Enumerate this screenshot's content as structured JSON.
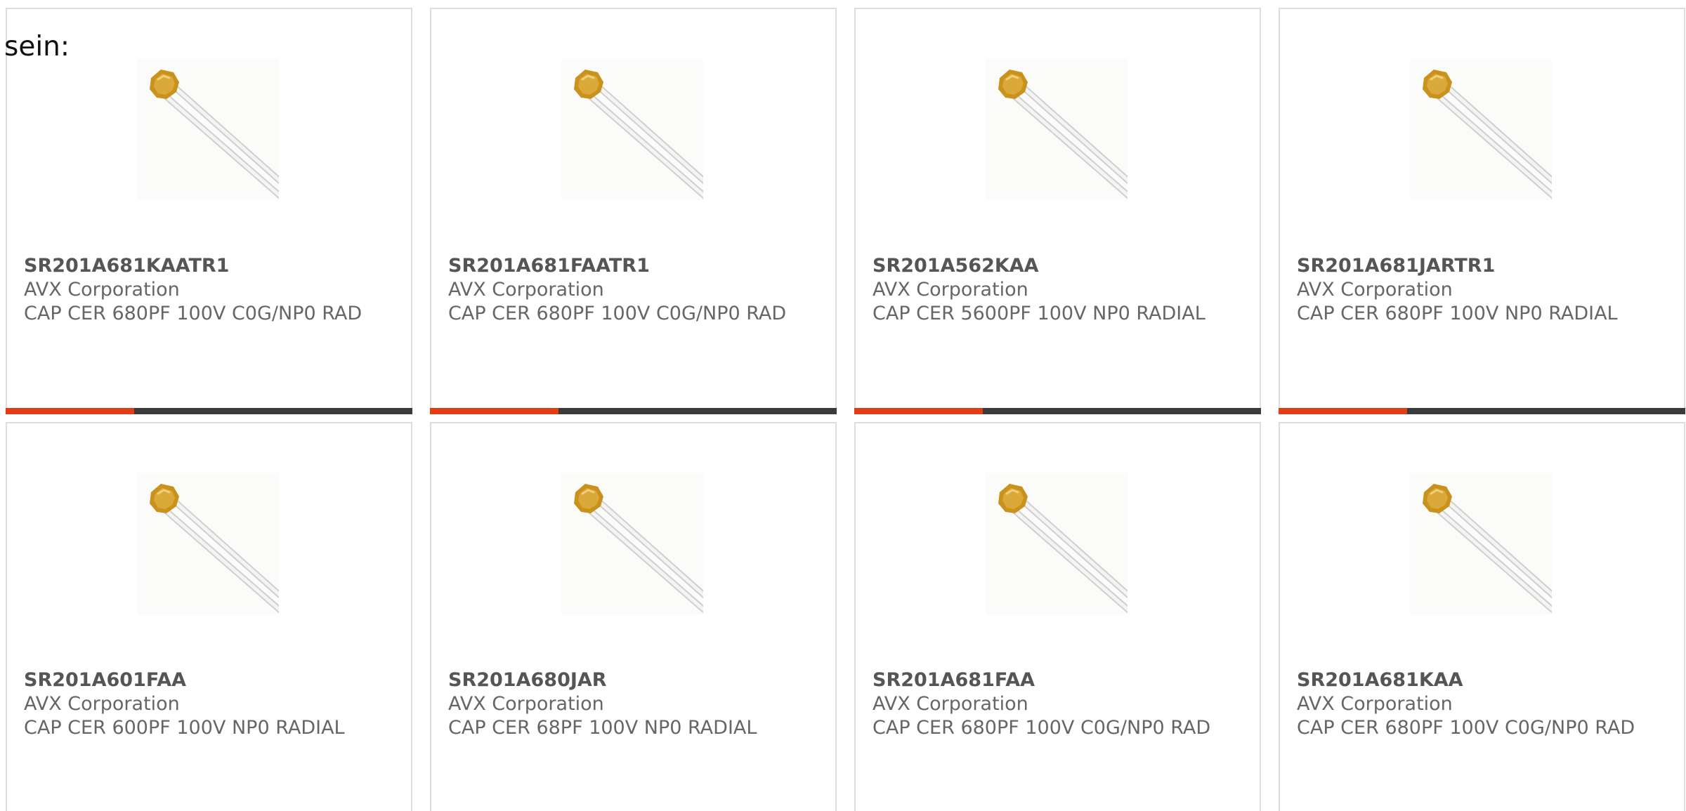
{
  "intro_text": "sein:",
  "colors": {
    "accent": "#e23d15",
    "bar": "#3b3b3b",
    "border": "#dddddd",
    "text": "#666666"
  },
  "products": [
    {
      "part_number": "SR201A681KAATR1",
      "manufacturer": "AVX Corporation",
      "description": "CAP CER 680PF 100V C0G/NP0 RAD",
      "image_icon": "radial-ceramic-capacitor-image"
    },
    {
      "part_number": "SR201A681FAATR1",
      "manufacturer": "AVX Corporation",
      "description": "CAP CER 680PF 100V C0G/NP0 RAD",
      "image_icon": "radial-ceramic-capacitor-image"
    },
    {
      "part_number": "SR201A562KAA",
      "manufacturer": "AVX Corporation",
      "description": "CAP CER 5600PF 100V NP0 RADIAL",
      "image_icon": "radial-ceramic-capacitor-image"
    },
    {
      "part_number": "SR201A681JARTR1",
      "manufacturer": "AVX Corporation",
      "description": "CAP CER 680PF 100V NP0 RADIAL",
      "image_icon": "radial-ceramic-capacitor-image"
    },
    {
      "part_number": "SR201A601FAA",
      "manufacturer": "AVX Corporation",
      "description": "CAP CER 600PF 100V NP0 RADIAL",
      "image_icon": "radial-ceramic-capacitor-image"
    },
    {
      "part_number": "SR201A680JAR",
      "manufacturer": "AVX Corporation",
      "description": "CAP CER 68PF 100V NP0 RADIAL",
      "image_icon": "radial-ceramic-capacitor-image"
    },
    {
      "part_number": "SR201A681FAA",
      "manufacturer": "AVX Corporation",
      "description": "CAP CER 680PF 100V C0G/NP0 RAD",
      "image_icon": "radial-ceramic-capacitor-image"
    },
    {
      "part_number": "SR201A681KAA",
      "manufacturer": "AVX Corporation",
      "description": "CAP CER 680PF 100V C0G/NP0 RAD",
      "image_icon": "radial-ceramic-capacitor-image"
    }
  ]
}
